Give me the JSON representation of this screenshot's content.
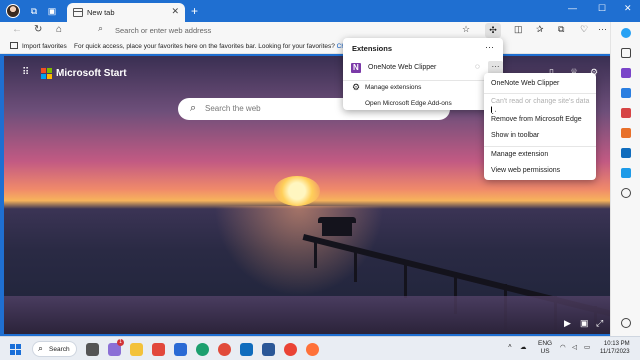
{
  "browser": {
    "tab_title": "New tab",
    "tab_close": "✕",
    "new_tab": "+",
    "window_controls": [
      "—",
      "☐",
      "✕"
    ]
  },
  "toolbar": {
    "address_placeholder": "Search or enter web address"
  },
  "favorites_bar": {
    "import_label": "Import favorites",
    "message": "For quick access, place your favorites here on the favorites bar. Looking for your favorites?",
    "link_text": "Check"
  },
  "start_page": {
    "brand": "Microsoft Start",
    "search_placeholder": "Search the web"
  },
  "extensions_panel": {
    "title": "Extensions",
    "more": "···",
    "extension_name": "OneNote Web Clipper",
    "item_more": "···",
    "manage_label": "Manage extensions",
    "addons_label": "Open Microsoft Edge Add-ons"
  },
  "context_menu": {
    "items": [
      {
        "label": "OneNote Web Clipper",
        "disabled": false
      },
      {
        "label": "Can't read or change site's data",
        "disabled": true
      },
      {
        "label": "Remove from Microsoft Edge",
        "disabled": false
      },
      {
        "label": "Show in toolbar",
        "disabled": false
      },
      {
        "label": "Manage extension",
        "disabled": false
      },
      {
        "label": "View web permissions",
        "disabled": false
      }
    ]
  },
  "taskbar": {
    "search_label": "Search",
    "notification_count": "1",
    "language": "ENG",
    "region": "US",
    "time": "10:13 PM",
    "date": "11/17/2023"
  }
}
